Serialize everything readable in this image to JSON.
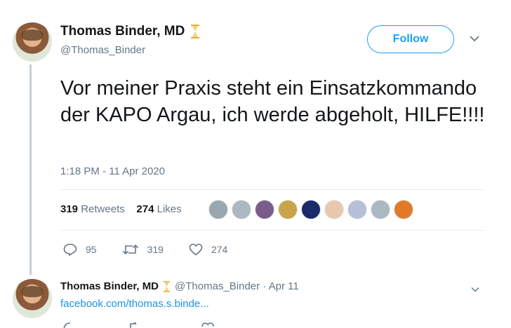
{
  "tweet": {
    "display_name": "Thomas Binder, MD",
    "handle": "@Thomas_Binder",
    "follow_label": "Follow",
    "text": "Vor meiner Praxis steht ein Einsatzkommando der KAPO Argau, ich werde abgeholt, HILFE!!!!",
    "timestamp": "1:18 PM - 11 Apr 2020",
    "retweets_count": "319",
    "retweets_label": "Retweets",
    "likes_count": "274",
    "likes_label": "Likes",
    "actions": {
      "replies": "95",
      "retweets": "319",
      "likes": "274"
    },
    "liker_avatar_colors": [
      "#9aa7ae",
      "#aab8c2",
      "#7a5c8a",
      "#c8a44a",
      "#1a2a6a",
      "#e8c9b0",
      "#b7bfd6",
      "#aab8c2",
      "#e07a2a"
    ]
  },
  "reply": {
    "display_name": "Thomas Binder, MD",
    "meta": "@Thomas_Binder · Apr 11",
    "link": "facebook.com/thomas.s.binde..."
  },
  "colors": {
    "accent": "#1da1f2",
    "secondary_text": "#657786",
    "hourglass": "#e2b13c"
  }
}
